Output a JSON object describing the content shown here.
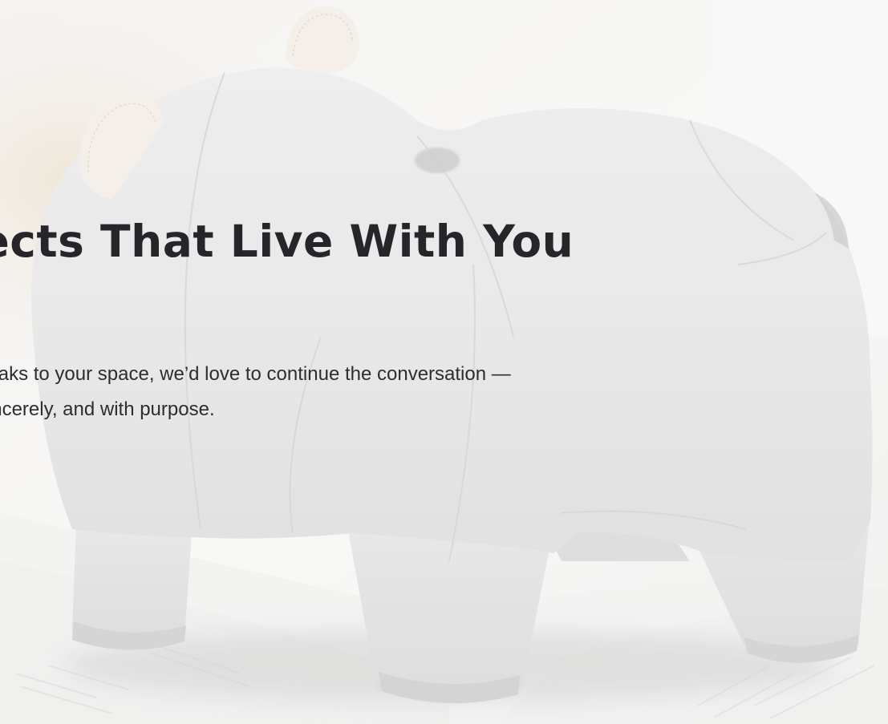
{
  "hero": {
    "heading": "Objects That Live With You",
    "text": "If this speaks to your space, we’d love to continue the conversation — slowly, sincerely, and with purpose."
  },
  "colors": {
    "heading": "#27242a",
    "body_text": "#2f2c31",
    "background": "#f5f5f4",
    "object_body": "#e5e5e5",
    "object_ears": "#f3eee6"
  }
}
